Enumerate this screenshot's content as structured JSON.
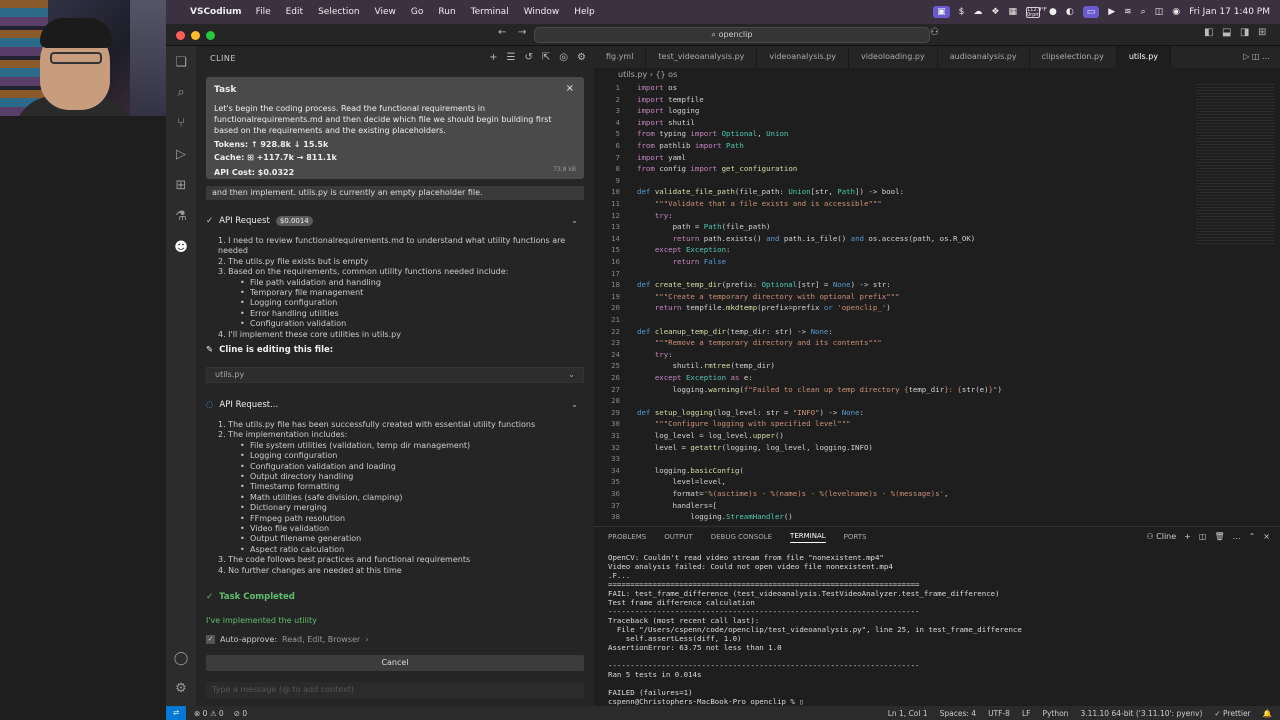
{
  "menubar": {
    "app_name": "VSCodium",
    "menus": [
      "File",
      "Edit",
      "Selection",
      "View",
      "Go",
      "Run",
      "Terminal",
      "Window",
      "Help"
    ],
    "weather": "112.9°F",
    "weather_sub": "0rpm",
    "datetime": "Fri Jan 17  1:40 PM"
  },
  "titlebar": {
    "search": "openclip"
  },
  "sidebar": {
    "title": "CLINE",
    "task": {
      "label": "Task",
      "text": "Let's begin the coding process. Read the functional requirements in functionalrequirements.md and then decide which file we should begin building first based on the requirements and the existing placeholders.",
      "tokens": "Tokens: ↑ 928.8k ↓ 15.5k",
      "cache": "Cache: ⊞ +117.7k → 811.1k",
      "cost": "API Cost: $0.0322",
      "size": "73.8 kB"
    },
    "strip": "and then implement. utils.py is currently an empty placeholder file.",
    "api1": {
      "label": "API Request",
      "cost": "$0.0014",
      "items": [
        {
          "t": "1. I need to review functionalrequirements.md to understand what utility functions are needed",
          "sub": false
        },
        {
          "t": "2. The utils.py file exists but is empty",
          "sub": false
        },
        {
          "t": "3. Based on the requirements, common utility functions needed include:",
          "sub": false
        },
        {
          "t": "File path validation and handling",
          "sub": true
        },
        {
          "t": "Temporary file management",
          "sub": true
        },
        {
          "t": "Logging configuration",
          "sub": true
        },
        {
          "t": "Error handling utilities",
          "sub": true
        },
        {
          "t": "Configuration validation",
          "sub": true
        },
        {
          "t": "4. I'll implement these core utilities in utils.py",
          "sub": false
        }
      ]
    },
    "editing": {
      "label": "Cline is editing this file:",
      "file": "utils.py"
    },
    "api2": {
      "label": "API Request...",
      "items": [
        {
          "t": "1. The utils.py file has been successfully created with essential utility functions",
          "sub": false
        },
        {
          "t": "2. The implementation includes:",
          "sub": false
        },
        {
          "t": "File system utilities (validation, temp dir management)",
          "sub": true
        },
        {
          "t": "Logging configuration",
          "sub": true
        },
        {
          "t": "Configuration validation and loading",
          "sub": true
        },
        {
          "t": "Output directory handling",
          "sub": true
        },
        {
          "t": "Timestamp formatting",
          "sub": true
        },
        {
          "t": "Math utilities (safe division, clamping)",
          "sub": true
        },
        {
          "t": "Dictionary merging",
          "sub": true
        },
        {
          "t": "FFmpeg path resolution",
          "sub": true
        },
        {
          "t": "Video file validation",
          "sub": true
        },
        {
          "t": "Output filename generation",
          "sub": true
        },
        {
          "t": "Aspect ratio calculation",
          "sub": true
        },
        {
          "t": "3. The code follows best practices and functional requirements",
          "sub": false
        },
        {
          "t": "4. No further changes are needed at this time",
          "sub": false
        }
      ]
    },
    "completed": "Task Completed",
    "implemented": "I've implemented the utility",
    "auto_approve": "Auto-approve:",
    "auto_approve_value": "Read, Edit, Browser",
    "cancel": "Cancel",
    "chat_placeholder": "Type a message (@ to add context)"
  },
  "editor": {
    "tabs": [
      "fig.yml",
      "test_videoanalysis.py",
      "videoanalysis.py",
      "videoloading.py",
      "audioanalysis.py",
      "clipselection.py",
      "utils.py"
    ],
    "active_tab": "utils.py",
    "breadcrumb": "utils.py  ›  {} os",
    "code": [
      {
        "n": "1",
        "h": "<span class='kw'>import</span> os"
      },
      {
        "n": "2",
        "h": "<span class='kw'>import</span> tempfile"
      },
      {
        "n": "3",
        "h": "<span class='kw'>import</span> logging"
      },
      {
        "n": "4",
        "h": "<span class='kw'>import</span> shutil"
      },
      {
        "n": "5",
        "h": "<span class='kw'>from</span> typing <span class='kw'>import</span> <span class='ty'>Optional</span>, <span class='ty'>Union</span>"
      },
      {
        "n": "6",
        "h": "<span class='kw'>from</span> pathlib <span class='kw'>import</span> <span class='ty'>Path</span>"
      },
      {
        "n": "7",
        "h": "<span class='kw'>import</span> yaml"
      },
      {
        "n": "8",
        "h": "<span class='kw'>from</span> config <span class='kw'>import</span> <span class='fn'>get_configuration</span>"
      },
      {
        "n": "9",
        "h": ""
      },
      {
        "n": "10",
        "h": "<span class='df'>def</span> <span class='fn'>validate_file_path</span>(file_path: <span class='ty'>Union</span>[str, <span class='ty'>Path</span>]) -> bool:"
      },
      {
        "n": "11",
        "h": "    <span class='st'>\"\"\"Validate that a file exists and is accessible\"\"\"</span>"
      },
      {
        "n": "12",
        "h": "    <span class='kw'>try</span>:"
      },
      {
        "n": "13",
        "h": "        path = <span class='ty'>Path</span>(file_path)"
      },
      {
        "n": "14",
        "h": "        <span class='kw'>return</span> path.exists() <span class='df'>and</span> path.is_file() <span class='df'>and</span> os.access(path, os.R_OK)"
      },
      {
        "n": "15",
        "h": "    <span class='kw'>except</span> <span class='ty'>Exception</span>:"
      },
      {
        "n": "16",
        "h": "        <span class='kw'>return</span> <span class='df'>False</span>"
      },
      {
        "n": "17",
        "h": ""
      },
      {
        "n": "18",
        "h": "<span class='df'>def</span> <span class='fn'>create_temp_dir</span>(prefix: <span class='ty'>Optional</span>[str] = <span class='df'>None</span>) -> str:"
      },
      {
        "n": "19",
        "h": "    <span class='st'>\"\"\"Create a temporary directory with optional prefix\"\"\"</span>"
      },
      {
        "n": "20",
        "h": "    <span class='kw'>return</span> tempfile.<span class='fn'>mkdtemp</span>(prefix=prefix <span class='df'>or</span> <span class='st'>'openclip_'</span>)"
      },
      {
        "n": "21",
        "h": ""
      },
      {
        "n": "22",
        "h": "<span class='df'>def</span> <span class='fn'>cleanup_temp_dir</span>(temp_dir: str) -> <span class='df'>None</span>:"
      },
      {
        "n": "23",
        "h": "    <span class='st'>\"\"\"Remove a temporary directory and its contents\"\"\"</span>"
      },
      {
        "n": "24",
        "h": "    <span class='kw'>try</span>:"
      },
      {
        "n": "25",
        "h": "        shutil.<span class='fn'>rmtree</span>(temp_dir)"
      },
      {
        "n": "26",
        "h": "    <span class='kw'>except</span> <span class='ty'>Exception</span> <span class='kw'>as</span> e:"
      },
      {
        "n": "27",
        "h": "        logging.<span class='fn'>warning</span>(<span class='st'>f\"Failed to clean up temp directory {</span>temp_dir<span class='st'>}: {</span>str(e)<span class='st'>}\"</span>)"
      },
      {
        "n": "28",
        "h": ""
      },
      {
        "n": "29",
        "h": "<span class='df'>def</span> <span class='fn'>setup_logging</span>(log_level: str = <span class='st'>\"INFO\"</span>) -> <span class='df'>None</span>:"
      },
      {
        "n": "30",
        "h": "    <span class='st'>\"\"\"Configure logging with specified level\"\"\"</span>"
      },
      {
        "n": "31",
        "h": "    log_level = log_level.<span class='fn'>upper</span>()"
      },
      {
        "n": "32",
        "h": "    level = <span class='fn'>getattr</span>(logging, log_level, logging.INFO)"
      },
      {
        "n": "33",
        "h": ""
      },
      {
        "n": "34",
        "h": "    logging.<span class='fn'>basicConfig</span>("
      },
      {
        "n": "35",
        "h": "        level=level,"
      },
      {
        "n": "36",
        "h": "        format=<span class='st'>'%(asctime)s - %(name)s - %(levelname)s - %(message)s'</span>,"
      },
      {
        "n": "37",
        "h": "        handlers=["
      },
      {
        "n": "38",
        "h": "            logging.<span class='ty'>StreamHandler</span>()"
      }
    ]
  },
  "panel": {
    "tabs": [
      "PROBLEMS",
      "OUTPUT",
      "DEBUG CONSOLE",
      "TERMINAL",
      "PORTS"
    ],
    "active": "TERMINAL",
    "shell": "Cline",
    "terminal": "OpenCV: Couldn't read video stream from file \"nonexistent.mp4\"\nVideo analysis failed: Could not open video file nonexistent.mp4\n.F...\n======================================================================\nFAIL: test_frame_difference (test_videoanalysis.TestVideoAnalyzer.test_frame_difference)\nTest frame difference calculation\n----------------------------------------------------------------------\nTraceback (most recent call last):\n  File \"/Users/cspenn/code/openclip/test_videoanalysis.py\", line 25, in test_frame_difference\n    self.assertLess(diff, 1.0)\nAssertionError: 63.75 not less than 1.0\n\n----------------------------------------------------------------------\nRan 5 tests in 0.014s\n\nFAILED (failures=1)\ncspenn@Christophers-MacBook-Pro openclip % ▯"
  },
  "statusbar": {
    "problems": "⊗ 0 ⚠ 0",
    "ports": "⊘ 0",
    "position": "Ln 1, Col 1",
    "spaces": "Spaces: 4",
    "encoding": "UTF-8",
    "eol": "LF",
    "language": "Python",
    "interpreter": "3.11.10 64-bit ('3.11.10': pyenv)",
    "formatter": "✓ Prettier"
  }
}
